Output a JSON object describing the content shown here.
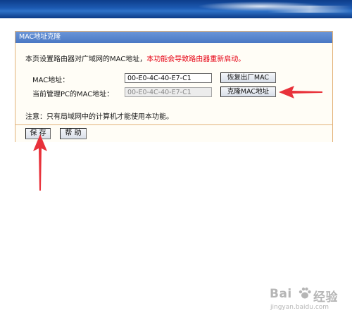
{
  "panel": {
    "title": "MAC地址克隆",
    "intro_text": "本页设置路由器对广域网的MAC地址，",
    "intro_warning": "本功能会导致路由器重新启动。",
    "mac_label": "MAC地址：",
    "mac_value": "00-E0-4C-40-E7-C1",
    "restore_button": "恢复出厂MAC",
    "pc_mac_label": "当前管理PC的MAC地址：",
    "pc_mac_value": "00-E0-4C-40-E7-C1",
    "clone_button": "克隆MAC地址",
    "note": "注意：只有局域网中的计算机才能使用本功能。",
    "save_button": "保 存",
    "help_button": "帮 助"
  },
  "watermark": {
    "brand_left": "Bai",
    "brand_right": "经验",
    "url": "jingyan.baidu.com"
  },
  "colors": {
    "warning": "#e60012",
    "annotation_arrow": "#e8313a",
    "title_bar": "#4a78c4",
    "panel_border": "#e3b37a"
  }
}
